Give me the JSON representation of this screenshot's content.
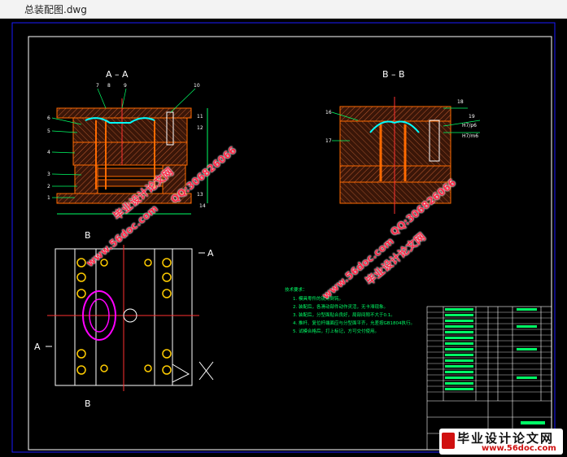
{
  "window": {
    "title": "总装配图.dwg"
  },
  "drawing": {
    "section_aa": "A – A",
    "section_bb": "B – B",
    "marker_a": "A",
    "marker_b": "B",
    "numbers_aa": [
      "7",
      "8",
      "9",
      "10",
      "6",
      "5",
      "4",
      "3",
      "2",
      "1",
      "11",
      "12",
      "13",
      "14"
    ],
    "numbers_bb": [
      "16",
      "17",
      "18",
      "19"
    ],
    "fit_label_1": "H7/p6",
    "fit_label_2": "H7/m6",
    "notes_title": "技术要求：",
    "notes": [
      "1. 模具零件的锐角倒钝。",
      "2. 装配后，各滑动部件动作灵活，无卡滞现象。",
      "3. 装配后，分型面贴合良好，局部间隙不大于0.1。",
      "4. 推杆、复位杆端面应与分型面平齐，允差按GB1804执行。",
      "5. 试模合格后，打上标记，方可交付使用。"
    ]
  },
  "watermarks": {
    "text_1": "毕业设计论文网",
    "text_2": "www.56doc.com",
    "text_3": "QQ:306826066"
  },
  "footer_brand": {
    "main": "毕业设计论文网",
    "url": "www.56doc.com"
  },
  "colors": {
    "background": "#000000",
    "frame": "#1a1aff",
    "part": "#ff6a00",
    "hatch": "#c05a30",
    "dim": "#00ff66",
    "text": "#ffffff"
  }
}
